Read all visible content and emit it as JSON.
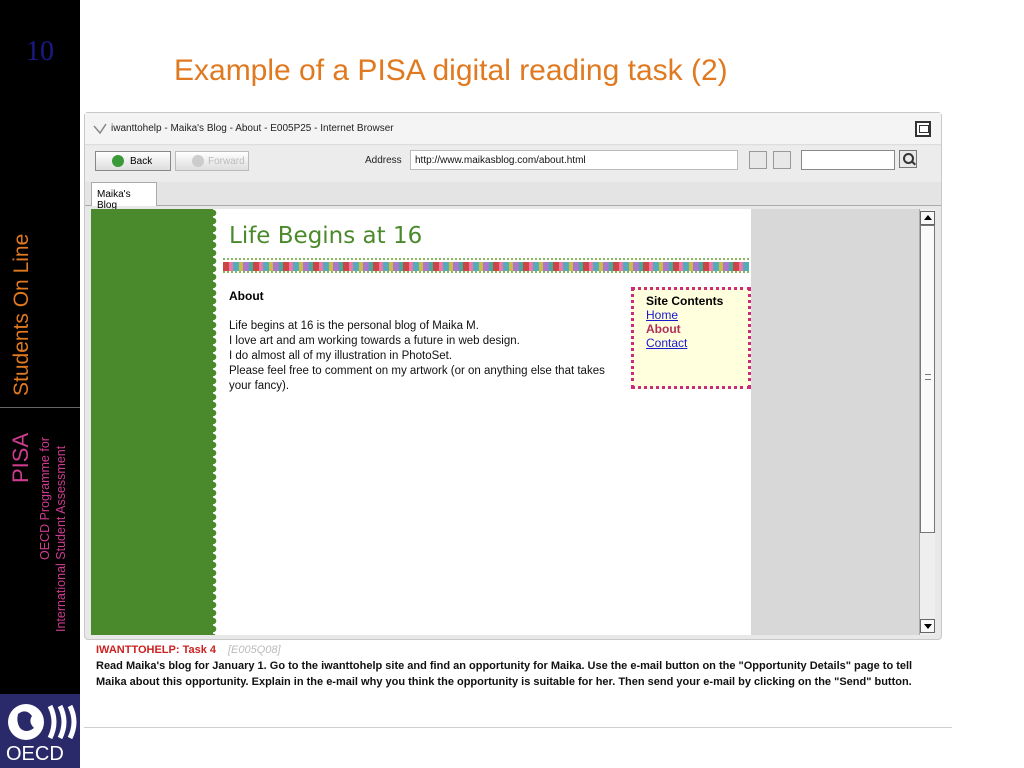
{
  "slide": {
    "number": "10",
    "title": "Example of a PISA digital reading task (2)",
    "sidebar_students": "Students On Line",
    "sidebar_pisa": "PISA",
    "sidebar_oecd_programme": "OECD Programme for",
    "sidebar_international": "International Student Assessment",
    "logo_text": "OECD"
  },
  "browser": {
    "title": "iwanttohelp - Maika's Blog - About - E005P25 - Internet Browser",
    "back_label": "Back",
    "forward_label": "Forward",
    "address_label": "Address",
    "address_value": "http://www.maikasblog.com/about.html",
    "tab_label": "Maika's Blog"
  },
  "blog": {
    "title": "Life Begins at 16",
    "heading": "About",
    "lines": [
      "Life begins at 16 is the personal blog of Maika M.",
      "I love art and am working towards a future in web design.",
      "I do almost all of my illustration in PhotoSet.",
      "Please feel free to comment on my artwork (or on anything else that takes your fancy)."
    ],
    "site_contents": {
      "title": "Site Contents",
      "home": "Home",
      "about": "About",
      "contact": "Contact"
    }
  },
  "task": {
    "label": "IWANTTOHELP: Task 4",
    "code": "[E005Q08]",
    "text": "Read Maika's blog for January 1. Go to the iwanttohelp site and find an opportunity for Maika. Use the e-mail button on the \"Opportunity Details\" page to tell Maika about this opportunity. Explain in the e-mail why you think the opportunity is suitable for her. Then send your e-mail by clicking on the \"Send\" button."
  },
  "colors": {
    "accent_orange": "#e0791f",
    "accent_magenta": "#cf3c8f",
    "blog_green": "#4b8a2c"
  }
}
